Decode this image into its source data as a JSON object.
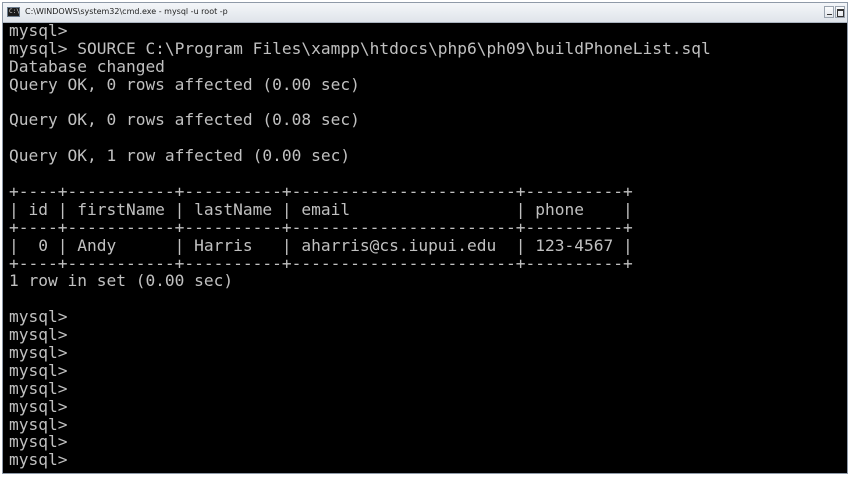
{
  "window": {
    "title": "C:\\WINDOWS\\system32\\cmd.exe - mysql -u root -p",
    "icon": "command-prompt-icon",
    "controls": [
      "minimize-icon",
      "maximize-icon"
    ]
  },
  "colors": {
    "console_background": "#000000",
    "console_text": "#c0c0c0",
    "titlebar": "#e9edf1"
  },
  "console": {
    "lines": [
      "mysql>",
      "mysql> SOURCE C:\\Program Files\\xampp\\htdocs\\php6\\ph09\\buildPhoneList.sql",
      "Database changed",
      "Query OK, 0 rows affected (0.00 sec)",
      "",
      "Query OK, 0 rows affected (0.08 sec)",
      "",
      "Query OK, 1 row affected (0.00 sec)",
      "",
      "+----+-----------+----------+-----------------------+----------+",
      "| id | firstName | lastName | email                 | phone    |",
      "+----+-----------+----------+-----------------------+----------+",
      "|  0 | Andy      | Harris   | aharris@cs.iupui.edu  | 123-4567 |",
      "+----+-----------+----------+-----------------------+----------+",
      "1 row in set (0.00 sec)",
      "",
      "mysql>",
      "mysql>",
      "mysql>",
      "mysql>",
      "mysql>",
      "mysql>",
      "mysql>",
      "mysql>",
      "mysql>"
    ]
  }
}
